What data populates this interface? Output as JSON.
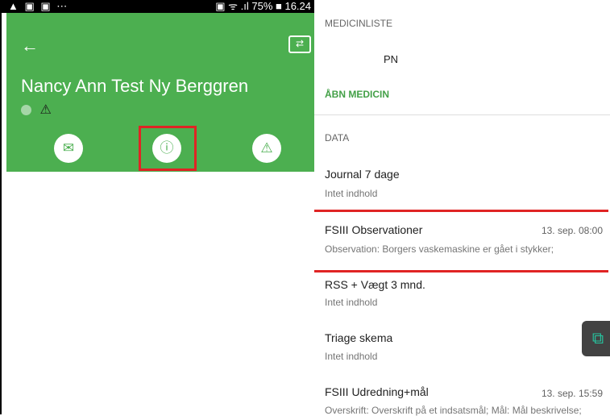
{
  "statusbar": {
    "left_icons": "▲ ▣ ▣ ⋯",
    "right_text": "▣ ᯤ .ıl 75% ■ 16.24"
  },
  "header": {
    "back_icon": "arrow-left-icon",
    "swap_icon": "swap-icon",
    "patient_name": "Nancy Ann Test Ny Berggren",
    "header_color": "#4caf50"
  },
  "actions": [
    {
      "icon": "mail-icon"
    },
    {
      "icon": "info-icon"
    },
    {
      "icon": "warning-icon"
    }
  ],
  "list": {
    "medicinliste_label": "MEDICINLISTE",
    "pn": "PN",
    "open_medicin": "ÅBN MEDICIN",
    "data_label": "DATA",
    "items": [
      {
        "title": "Journal 7 dage",
        "sub": "Intet indhold",
        "date": ""
      },
      {
        "title": "FSIII Observationer",
        "sub": "Observation: Borgers vaskemaskine er gået i stykker;",
        "date": "13. sep. 08:00"
      },
      {
        "title": "RSS + Vægt 3 mnd.",
        "sub": "Intet indhold",
        "date": ""
      },
      {
        "title": "Triage skema",
        "sub": "Intet indhold",
        "date": ""
      },
      {
        "title": "FSIII Udredning+mål",
        "sub": "Overskrift: Overskrift på et indsatsmål; Mål: Mål beskrivelse;",
        "date": "13. sep. 15:59"
      }
    ]
  },
  "highlight_color": "#e02424"
}
